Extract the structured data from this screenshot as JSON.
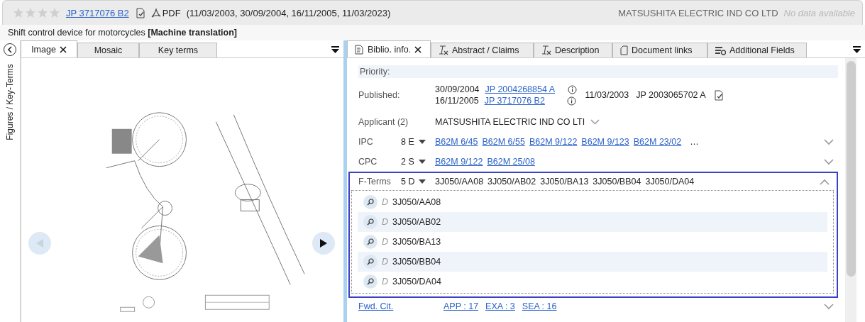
{
  "header": {
    "stars": 0,
    "patent_number": "JP 3717076 B2",
    "pdf_label": "PDF",
    "dates": "(11/03/2003, 30/09/2004, 16/11/2005, 11/03/2023)",
    "applicant": "MATSUSHITA ELECTRIC IND CO LTD",
    "status": "No data available"
  },
  "title": "Shift control device for motorcycles **[Machine translation]**",
  "left_panel": {
    "side_label": "Figures / Key-Terms",
    "tabs": [
      {
        "label": "Image",
        "selected": true
      },
      {
        "label": "Mosaic",
        "selected": false
      },
      {
        "label": "Key terms",
        "selected": false
      }
    ],
    "viewer": {
      "prev_disabled": true,
      "next_disabled": false
    }
  },
  "right_panel": {
    "tabs": [
      {
        "label": "Biblio. info.",
        "selected": true
      },
      {
        "label": "Abstract / Claims",
        "selected": false
      },
      {
        "label": "Description",
        "selected": false
      },
      {
        "label": "Document links",
        "selected": false
      },
      {
        "label": "Additional Fields",
        "selected": false
      }
    ],
    "priority_label": "Priority:",
    "published": {
      "label": "Published:",
      "entries": [
        {
          "date": "30/09/2004",
          "number": "JP 2004268854 A"
        },
        {
          "date": "16/11/2005",
          "number": "JP 3717076 B2"
        }
      ],
      "priority_date": "11/03/2003",
      "priority_number": "JP 2003065702 A"
    },
    "applicant": {
      "label": "Applicant (2)",
      "value": "MATSUSHITA ELECTRIC IND CO LTI"
    },
    "classifications": [
      {
        "label": "IPC",
        "count": "8 E",
        "codes": [
          "B62M 6/45",
          "B62M 6/55",
          "B62M 9/122",
          "B62M 9/123",
          "B62M 23/02"
        ],
        "more": "…",
        "expanded": false
      },
      {
        "label": "CPC",
        "count": "2 S",
        "codes": [
          "B62M 9/122",
          "B62M 25/08"
        ],
        "expanded": false
      }
    ],
    "fterms": {
      "label": "F-Terms",
      "count": "5 D",
      "summary": [
        "3J050/AA08",
        "3J050/AB02",
        "3J050/BA13",
        "3J050/BB04",
        "3J050/DA04"
      ],
      "expanded": true,
      "items": [
        {
          "marker": "D",
          "code": "3J050/AA08"
        },
        {
          "marker": "D",
          "code": "3J050/AB02"
        },
        {
          "marker": "D",
          "code": "3J050/BA13"
        },
        {
          "marker": "D",
          "code": "3J050/BB04"
        },
        {
          "marker": "D",
          "code": "3J050/DA04"
        }
      ]
    },
    "citations": {
      "label": "Fwd. Cit.",
      "links": [
        "APP : 17",
        "EXA : 3",
        "SEA : 16"
      ],
      "expanded": false
    }
  }
}
